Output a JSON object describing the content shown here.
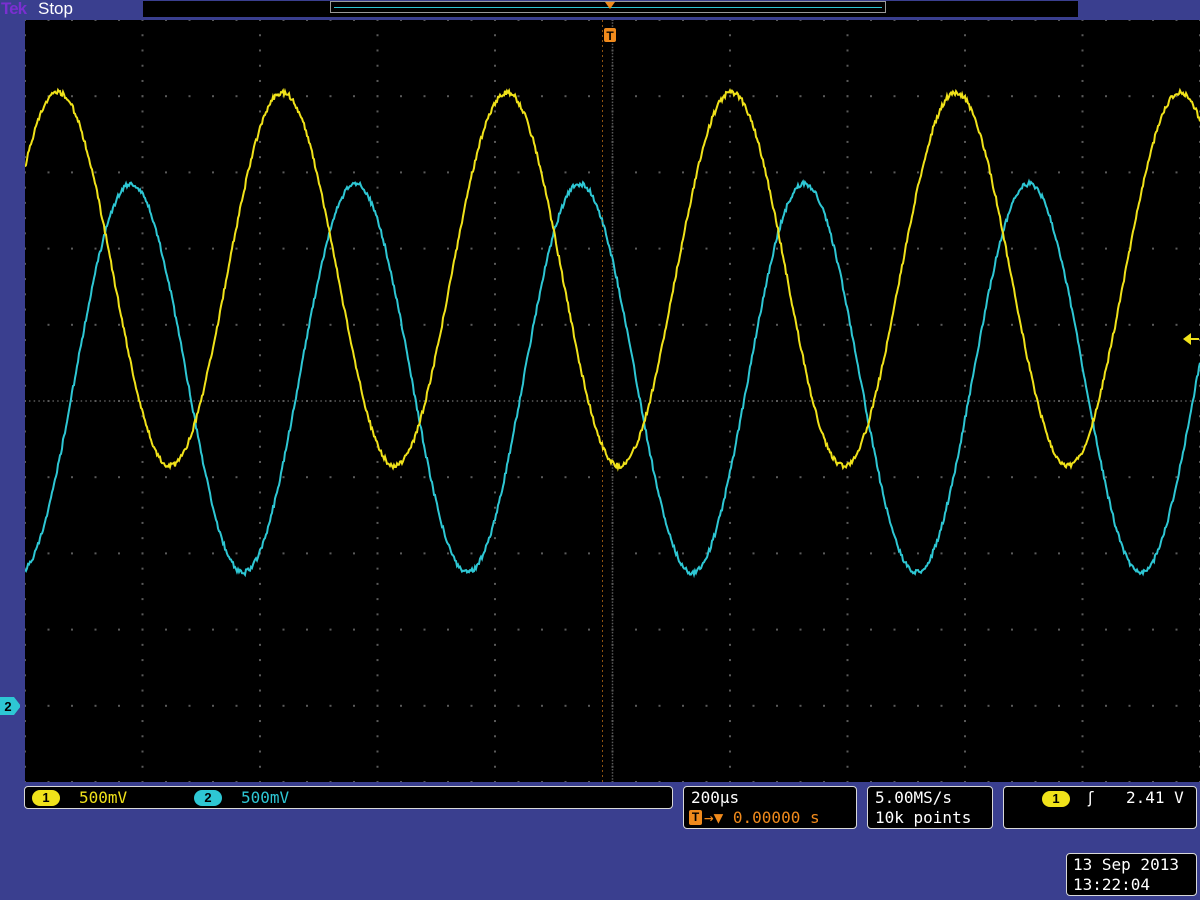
{
  "header": {
    "logo": "Tek",
    "acquisition_state": "Stop"
  },
  "colors": {
    "background": "#3a3f8f",
    "graticule": "#000000",
    "channel1": "#f0e21a",
    "channel2": "#2ec7d4",
    "trigger": "#f08a1c",
    "grid": "#5a5a5a"
  },
  "markers": {
    "trigger_position": "T",
    "channel2_ground": "2",
    "icons": [
      "trigger-position-icon",
      "channel2-ground-marker",
      "trigger-level-arrow-icon",
      "rising-edge-icon"
    ]
  },
  "channels": [
    {
      "badge": "1",
      "scale": "500mV",
      "color": "#f0e21a"
    },
    {
      "badge": "2",
      "scale": "500mV",
      "color": "#2ec7d4"
    }
  ],
  "timebase": {
    "scale": "200µs",
    "trigger_badge": "T",
    "delay": "→▼ 0.00000 s"
  },
  "acquisition": {
    "sample_rate": "5.00MS/s",
    "record_length": "10k points"
  },
  "trigger": {
    "source_badge": "1",
    "slope": "ʃ",
    "level": "2.41 V"
  },
  "datetime": {
    "date": "13 Sep  2013",
    "time": "13:22:04"
  },
  "waveforms": {
    "divisions": {
      "x": 10,
      "y": 10
    },
    "channel1": {
      "offset_div": 1.6,
      "amplitude_div": 2.45,
      "period_div": 1.91,
      "phase_deg": 37
    },
    "channel2": {
      "offset_div": 0.3,
      "amplitude_div": 2.55,
      "period_div": 1.91,
      "phase_deg": -80
    }
  }
}
